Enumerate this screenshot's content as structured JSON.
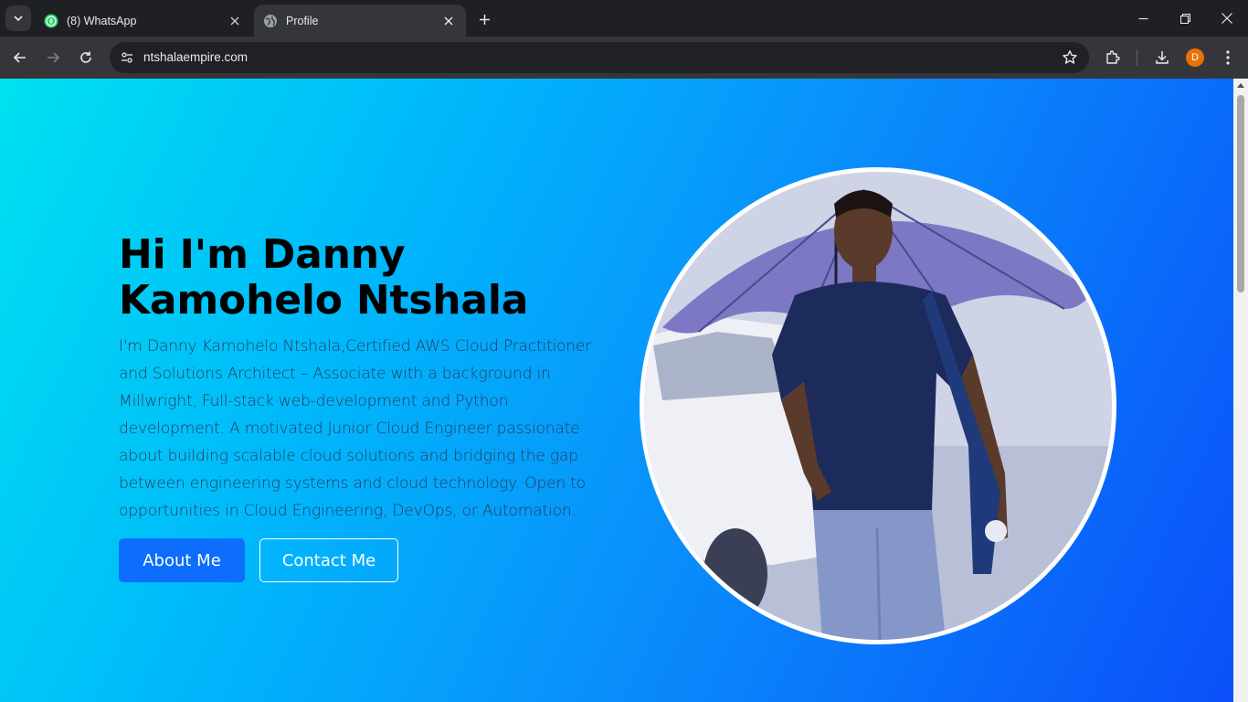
{
  "browser": {
    "tabs": [
      {
        "title": "(8) WhatsApp",
        "favicon": "whatsapp-icon",
        "badge": "8",
        "active": false
      },
      {
        "title": "Profile",
        "favicon": "globe-icon",
        "active": true
      }
    ],
    "address": "ntshalaempire.com",
    "profile_initial": "D"
  },
  "colors": {
    "gradient_start": "#00e1f0",
    "gradient_end": "#0b4ff9",
    "primary_button": "#0d6efd"
  },
  "hero": {
    "title_line1": "Hi I'm Danny",
    "title_line2": "Kamohelo Ntshala",
    "description": "I'm Danny Kamohelo Ntshala,Certified AWS Cloud Practitioner and Solutions Architect – Associate with a background in Millwright, Full-stack web-development and Python development. A motivated Junior Cloud Engineer passionate about building scalable cloud solutions and bridging the gap between engineering systems and cloud technology. Open to opportunities in Cloud Engineering, DevOps, or Automation.",
    "about_label": "About Me",
    "contact_label": "Contact Me"
  }
}
